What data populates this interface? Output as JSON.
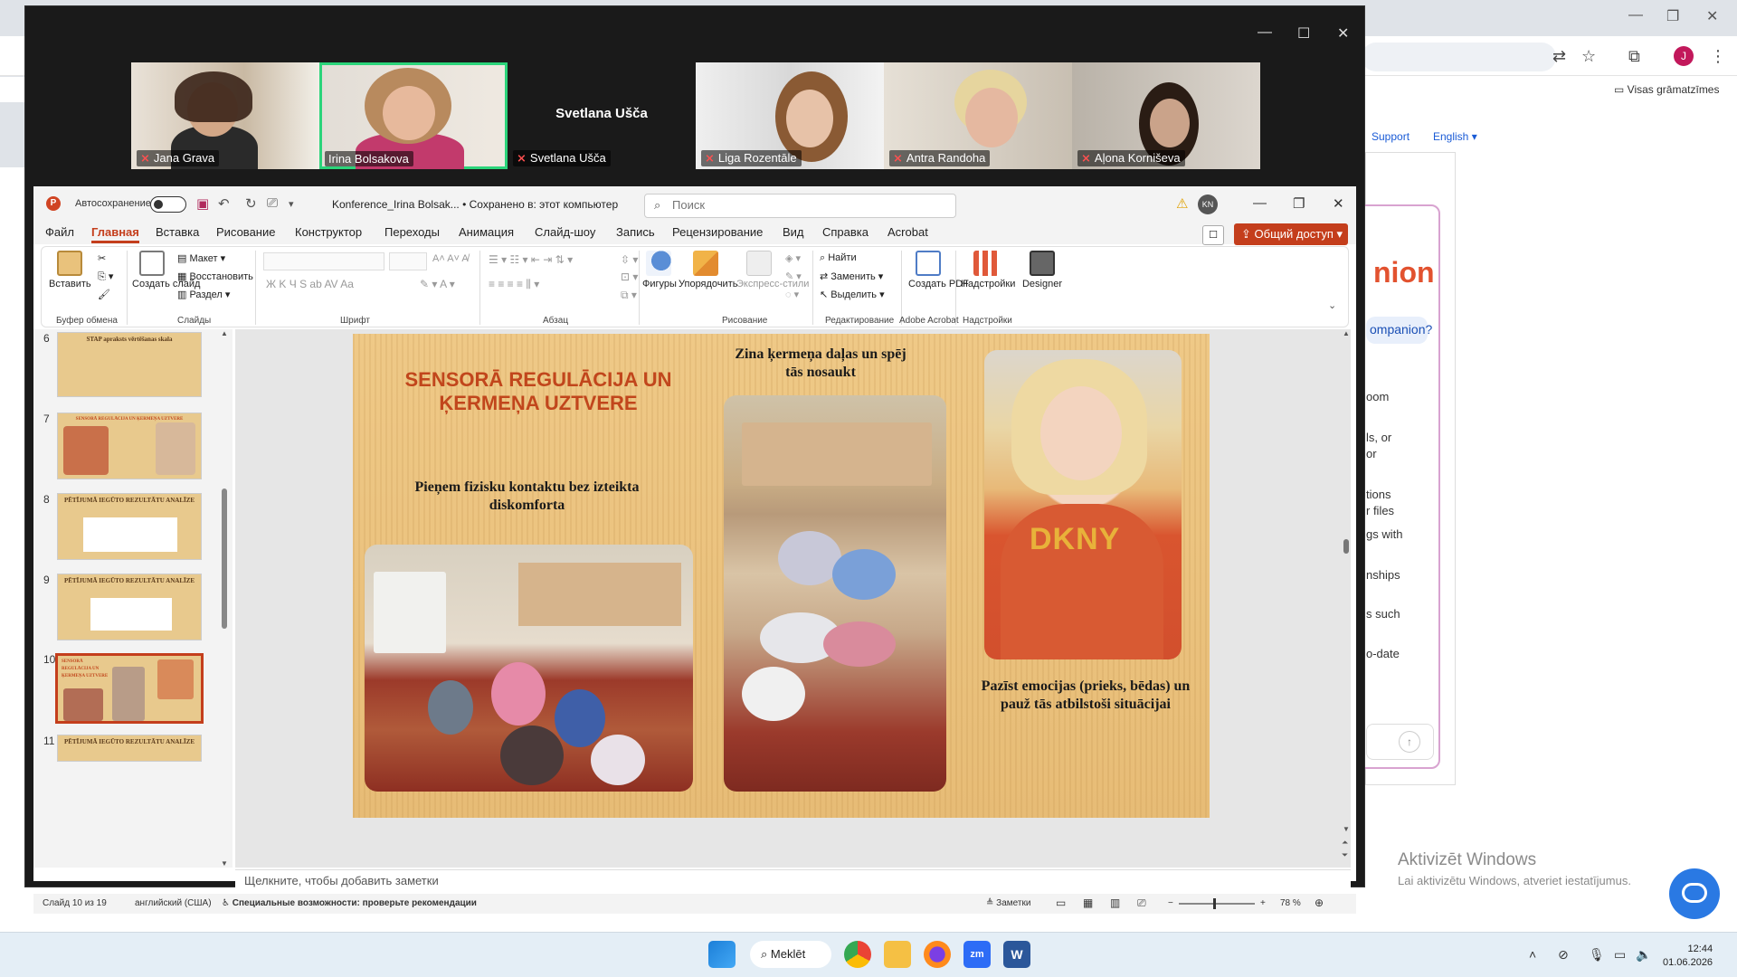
{
  "browser": {
    "bookmark_folder": "Visas grāmatzīmes",
    "link_support": "Support",
    "link_english": "English",
    "hero_fragment": "nion",
    "chip_fragment": "ompanion?",
    "lines": [
      "oom",
      "ls, or",
      "or",
      "tions",
      "r files",
      "gs with",
      "nships",
      "s such",
      "o-date"
    ],
    "avatar_letter": "J"
  },
  "windows_activation": {
    "line1": "Aktivizēt Windows",
    "line2": "Lai aktivizētu Windows, atveriet iestatījumus."
  },
  "zoom": {
    "participants": [
      {
        "name": "Jana Grava",
        "muted": true
      },
      {
        "name": "Irina Bolsakova",
        "muted": false,
        "active": true
      },
      {
        "name": "Svetlana Ušča",
        "muted": true,
        "no_video": true
      },
      {
        "name": "Liga Rozentāle",
        "muted": true
      },
      {
        "name": "Antra Randoha",
        "muted": true
      },
      {
        "name": "Aļona Korniševa",
        "muted": true
      }
    ]
  },
  "ppt": {
    "autosave_label": "Автосохранение",
    "doc_title": "Konference_Irina Bolsak...  •  Сохранено в: этот компьютер",
    "search_placeholder": "Поиск",
    "user_initials": "KN",
    "menu": [
      "Файл",
      "Главная",
      "Вставка",
      "Рисование",
      "Конструктор",
      "Переходы",
      "Анимация",
      "Слайд-шоу",
      "Запись",
      "Рецензирование",
      "Вид",
      "Справка",
      "Acrobat"
    ],
    "share_label": "Общий доступ",
    "ribbon": {
      "paste": "Вставить",
      "create_slide": "Создать слайд",
      "layout": "Макет",
      "restore": "Восстановить",
      "section": "Раздел",
      "shapes": "Фигуры",
      "arrange": "Упорядочить",
      "express_styles": "Экспресс-стили",
      "find": "Найти",
      "replace": "Заменить",
      "select": "Выделить",
      "create_pdf": "Создать PDF",
      "addins": "Надстройки",
      "designer": "Designer",
      "groups": {
        "clipboard": "Буфер обмена",
        "slides": "Слайды",
        "font": "Шрифт",
        "paragraph": "Абзац",
        "drawing": "Рисование",
        "editing": "Редактирование",
        "acrobat": "Adobe Acrobat",
        "addins": "Надстройки"
      }
    },
    "thumbnails": [
      {
        "num": "6",
        "title": "STAP apraksts vērtēšanas skala"
      },
      {
        "num": "7",
        "title": "SENSORĀ REGULĀCIJA UN ĶERMEŅA UZTVERE"
      },
      {
        "num": "8",
        "title": "PĒTĪJUMĀ IEGŪTO REZULTĀTU ANALĪZE"
      },
      {
        "num": "9",
        "title": "PĒTĪJUMĀ IEGŪTO REZULTĀTU ANALĪZE"
      },
      {
        "num": "10",
        "title": "SENSORĀ REGULĀCIJA UN ĶERMEŅA UZTVERE"
      },
      {
        "num": "11",
        "title": "PĒTĪJUMĀ IEGŪTO REZULTĀTU ANALĪZE"
      }
    ],
    "slide": {
      "title": "SENSORĀ REGULĀCIJA UN ĶERMEŅA UZTVERE",
      "caption_left": "Pieņem fizisku kontaktu bez izteikta diskomforta",
      "caption_center": "Zina ķermeņa daļas un spēj tās nosaukt",
      "caption_right": "Pazīst emocijas (prieks, bēdas) un pauž tās atbilstoši situācijai"
    },
    "notes_placeholder": "Щелкните, чтобы добавить заметки",
    "status": {
      "slide_of": "Слайд 10 из 19",
      "language": "английский (США)",
      "accessibility": "Специальные возможности: проверьте рекомендации",
      "notes": "Заметки",
      "zoom": "78 %"
    }
  },
  "taskbar": {
    "search": "Meklēt",
    "time": "12:44",
    "date": "01.06.2026"
  }
}
